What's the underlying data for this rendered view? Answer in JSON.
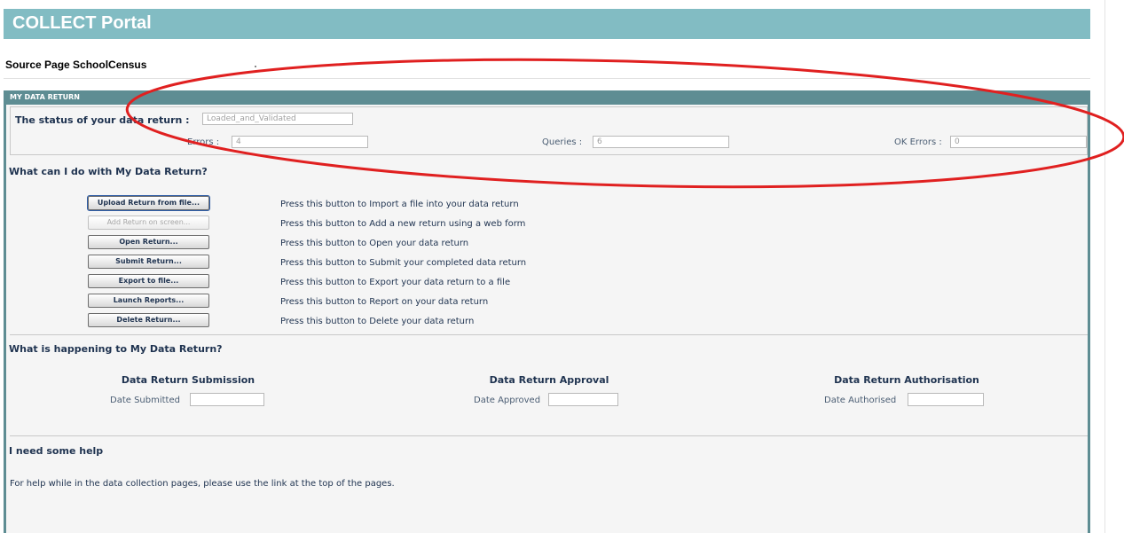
{
  "header": {
    "title": "COLLECT Portal"
  },
  "source": {
    "label": "Source Page SchoolCensus"
  },
  "panel": {
    "title": "MY DATA RETURN"
  },
  "status": {
    "label": "The status of your data return :",
    "value": "Loaded_and_Validated",
    "errors_label": "Errors :",
    "errors_value": "4",
    "queries_label": "Queries :",
    "queries_value": "6",
    "ok_errors_label": "OK Errors :",
    "ok_errors_value": "0"
  },
  "actions": {
    "heading": "What can I do with My Data Return?",
    "items": [
      {
        "button": "Upload Return from file...",
        "description": "Press this button to Import a file into your data return"
      },
      {
        "button": "Add Return on screen...",
        "description": "Press this button to Add a new return using a web form"
      },
      {
        "button": "Open Return...",
        "description": "Press this button to Open your data return"
      },
      {
        "button": "Submit Return...",
        "description": "Press this button to Submit your completed data return"
      },
      {
        "button": "Export to file...",
        "description": "Press this button to Export your data return to a file"
      },
      {
        "button": "Launch Reports...",
        "description": "Press this button to Report on your data return"
      },
      {
        "button": "Delete Return...",
        "description": "Press this button to Delete your data return"
      }
    ]
  },
  "happening": {
    "heading": "What is happening to My Data Return?",
    "submission": {
      "title": "Data Return Submission",
      "date_label": "Date Submitted",
      "date_value": ""
    },
    "approval": {
      "title": "Data Return Approval",
      "date_label": "Date Approved",
      "date_value": ""
    },
    "authorisation": {
      "title": "Data Return Authorisation",
      "date_label": "Date Authorised",
      "date_value": ""
    }
  },
  "help": {
    "heading": "I need some help",
    "text": "For help while in the data collection pages, please use the link at the top of the pages."
  },
  "colors": {
    "header_bg": "#82bcc3",
    "panel_head": "#5e8d93",
    "annotation": "#e02020"
  }
}
